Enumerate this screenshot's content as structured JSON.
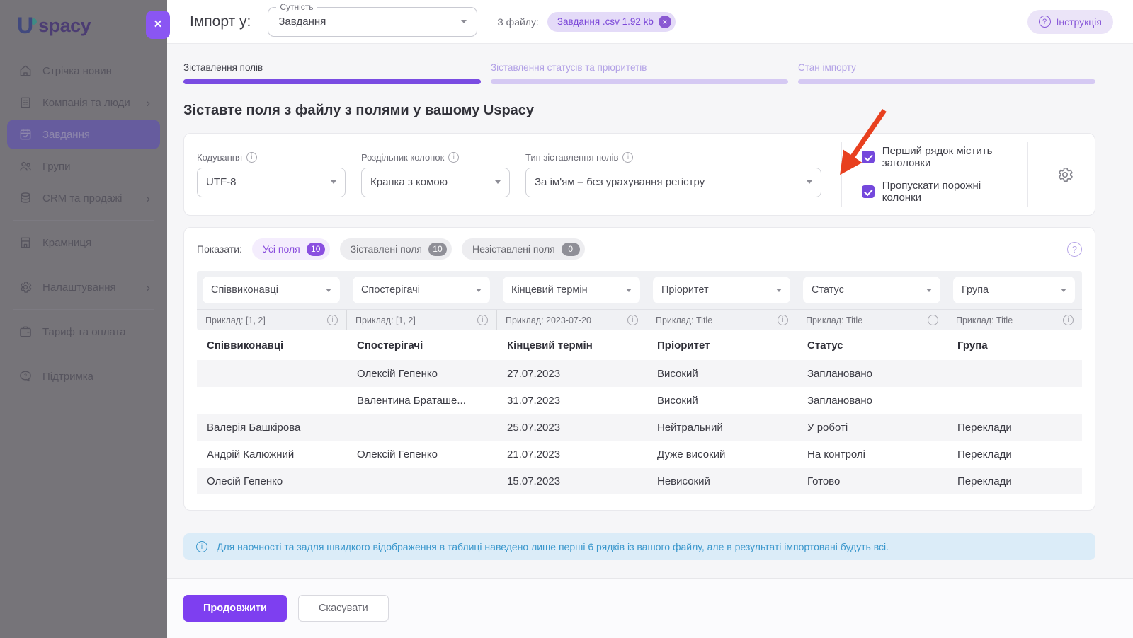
{
  "app": {
    "logo_letter": "U",
    "logo_text": "spacy"
  },
  "icons": {
    "info": "i",
    "question": "?",
    "close": "×",
    "chevron": "›"
  },
  "colors": {
    "accent": "#7e3ff0",
    "accent_light": "#e4dbf8",
    "step_active": "#7a4ce2",
    "step_inactive": "#d5c9f3",
    "banner_blue": "#3a97cc",
    "arrow_red": "#e8401f",
    "checkbox": "#7448dc"
  },
  "sidebar": {
    "items": [
      {
        "label": "Стрічка новин"
      },
      {
        "label": "Компанія та люди",
        "chevron": true
      },
      {
        "label": "Завдання",
        "active": true
      },
      {
        "label": "Групи"
      },
      {
        "label": "CRM та продажі",
        "chevron": true
      },
      {
        "label": "Крамниця"
      },
      {
        "label": "Налаштування",
        "chevron": true
      },
      {
        "label": "Тариф та оплата"
      },
      {
        "label": "Підтримка"
      }
    ]
  },
  "header": {
    "title": "Імпорт у:",
    "entity_label": "Сутність",
    "entity_value": "Завдання",
    "from_file_label": "З файлу:",
    "file_chip": "Завдання .csv 1.92 kb",
    "instruction_label": "Інструкція"
  },
  "steps": [
    {
      "label": "Зіставлення полів",
      "active": true
    },
    {
      "label": "Зіставлення статусів та пріоритетів",
      "active": false
    },
    {
      "label": "Стан імпорту",
      "active": false
    }
  ],
  "main": {
    "heading": "Зіставте поля з файлу з полями у вашому Uspacy"
  },
  "settings": {
    "fields": [
      {
        "label": "Кодування",
        "value": "UTF-8"
      },
      {
        "label": "Роздільник колонок",
        "value": "Крапка з комою"
      },
      {
        "label": "Тип зіставлення полів",
        "value": "За ім'ям – без урахування регістру"
      }
    ],
    "checkboxes": [
      {
        "label": "Перший рядок містить заголовки",
        "checked": true
      },
      {
        "label": "Пропускати порожні колонки",
        "checked": true
      }
    ]
  },
  "filters": {
    "label": "Показати:",
    "chips": [
      {
        "label": "Усі поля",
        "count": "10",
        "selected": true
      },
      {
        "label": "Зіставлені поля",
        "count": "10",
        "selected": false
      },
      {
        "label": "Незіставлені поля",
        "count": "0",
        "selected": false
      }
    ]
  },
  "mapping": {
    "selects": [
      "Співвиконавці",
      "Спостерігачі",
      "Кінцевий термін",
      "Пріоритет",
      "Статус",
      "Група"
    ],
    "examples": [
      "Приклад: [1, 2]",
      "Приклад: [1, 2]",
      "Приклад: 2023-07-20",
      "Приклад: Title",
      "Приклад: Title",
      "Приклад: Title"
    ]
  },
  "table": {
    "headers": [
      "Співвиконавці",
      "Спостерігачі",
      "Кінцевий термін",
      "Пріоритет",
      "Статус",
      "Група"
    ],
    "rows": [
      [
        "",
        "Олексій Гепенко",
        "27.07.2023",
        "Високий",
        "Заплановано",
        ""
      ],
      [
        "",
        "Валентина Браташе...",
        "31.07.2023",
        "Високий",
        "Заплановано",
        ""
      ],
      [
        "Валерія Башкірова",
        "",
        "25.07.2023",
        "Нейтральний",
        "У роботі",
        "Переклади"
      ],
      [
        "Андрій Калюжний",
        "Олексій Гепенко",
        "21.07.2023",
        "Дуже високий",
        "На контролі",
        "Переклади"
      ],
      [
        "Олесій Гепенко",
        "",
        "15.07.2023",
        "Невисокий",
        "Готово",
        "Переклади"
      ]
    ]
  },
  "banner": {
    "text": "Для наочності та задля швидкого відображення в таблиці наведено лише перші 6 рядків із вашого файлу, але в результаті імпортовані будуть всі."
  },
  "footer": {
    "continue_label": "Продовжити",
    "cancel_label": "Скасувати"
  }
}
